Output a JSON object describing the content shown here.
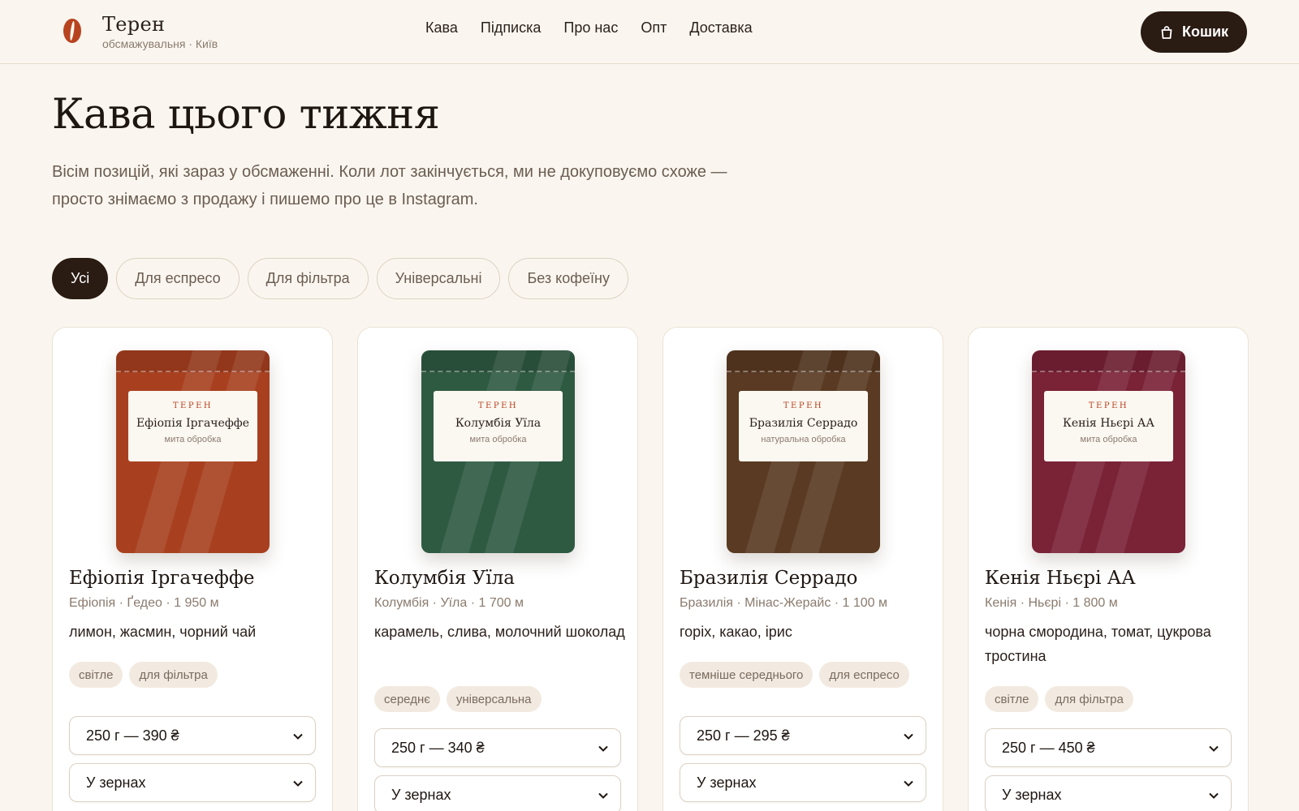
{
  "header": {
    "brand_name": "Терен",
    "brand_sub": "обсмажувальня · Київ",
    "nav": [
      "Кава",
      "Підписка",
      "Про нас",
      "Опт",
      "Доставка"
    ],
    "cart_label": "Кошик"
  },
  "main": {
    "title": "Кава цього тижня",
    "intro": "Вісім позицій, які зараз у обсмаженні. Коли лот закінчується, ми не докуповуємо схоже — просто знімаємо з продажу і пишемо про це в Instagram."
  },
  "filters": [
    "Усі",
    "Для еспресо",
    "Для фільтра",
    "Універсальні",
    "Без кофеїну"
  ],
  "active_filter": "Усі",
  "products": [
    {
      "pack_brand": "ТЕРЕН",
      "pack_name": "Ефіопія Іргачеффе",
      "pack_process": "мита обробка",
      "pack_color": "#a8401f",
      "name": "Ефіопія Іргачеффе",
      "origin": "Ефіопія · Ґедео · 1 950 м",
      "notes": "лимон, жасмин, чорний чай",
      "tags": [
        "світле",
        "для фільтра"
      ],
      "weight_option": "250 г — 390 ₴",
      "grind_option": "У зернах"
    },
    {
      "pack_brand": "ТЕРЕН",
      "pack_name": "Колумбія Уїла",
      "pack_process": "мита обробка",
      "pack_color": "#2f5a42",
      "name": "Колумбія Уїла",
      "origin": "Колумбія · Уїла · 1 700 м",
      "notes": "карамель, слива, молочний шоколад",
      "tags": [
        "середнє",
        "універсальна"
      ],
      "weight_option": "250 г — 340 ₴",
      "grind_option": "У зернах"
    },
    {
      "pack_brand": "ТЕРЕН",
      "pack_name": "Бразилія Серрадо",
      "pack_process": "натуральна обробка",
      "pack_color": "#5a3a22",
      "name": "Бразилія Серрадо",
      "origin": "Бразилія · Мінас-Жерайс · 1 100 м",
      "notes": "горіх, какао, ірис",
      "tags": [
        "темніше середнього",
        "для еспресо"
      ],
      "weight_option": "250 г — 295 ₴",
      "grind_option": "У зернах"
    },
    {
      "pack_brand": "ТЕРЕН",
      "pack_name": "Кенія Ньєрі АА",
      "pack_process": "мита обробка",
      "pack_color": "#7a2236",
      "name": "Кенія Ньєрі АА",
      "origin": "Кенія · Ньєрі · 1 800 м",
      "notes": "чорна смородина, томат, цукрова тростина",
      "tags": [
        "світле",
        "для фільтра"
      ],
      "weight_option": "250 г — 450 ₴",
      "grind_option": "У зернах"
    }
  ]
}
